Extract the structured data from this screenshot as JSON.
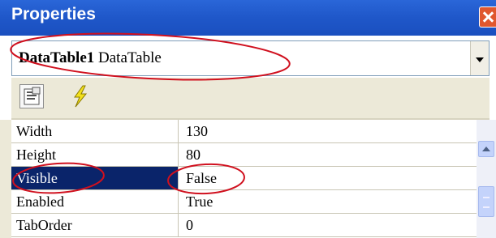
{
  "window": {
    "title": "Properties"
  },
  "object_selector": {
    "name": "DataTable1",
    "type": "DataTable"
  },
  "toolbar": {
    "buttons": [
      "properties-icon",
      "events-icon"
    ]
  },
  "properties": [
    {
      "name": "Width",
      "value": "130"
    },
    {
      "name": "Height",
      "value": "80"
    },
    {
      "name": "Visible",
      "value": "False",
      "selected": true
    },
    {
      "name": "Enabled",
      "value": "True"
    },
    {
      "name": "TabOrder",
      "value": "0"
    }
  ],
  "colors": {
    "title_bar": "#2060d0",
    "selection": "#0a246a",
    "annotation": "#d0101e"
  }
}
